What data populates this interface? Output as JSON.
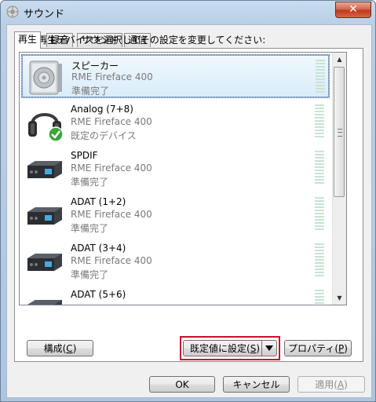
{
  "window": {
    "title": "サウンド",
    "close_label": "✕"
  },
  "tabs": [
    {
      "label": "再生",
      "active": true
    },
    {
      "label": "録音",
      "active": false
    },
    {
      "label": "サウンド",
      "active": false
    },
    {
      "label": "通信",
      "active": false
    }
  ],
  "instructions": "下の再生デバイスを選択してその設定を変更してください:",
  "devices": [
    {
      "name": "スピーカー",
      "driver": "RME Fireface 400",
      "status": "準備完了",
      "icon": "speaker-icon",
      "selected": true
    },
    {
      "name": "Analog (7+8)",
      "driver": "RME Fireface 400",
      "status": "既定のデバイス",
      "icon": "headphones-icon",
      "default": true
    },
    {
      "name": "SPDIF",
      "driver": "RME Fireface 400",
      "status": "準備完了",
      "icon": "audio-interface-icon"
    },
    {
      "name": "ADAT (1+2)",
      "driver": "RME Fireface 400",
      "status": "準備完了",
      "icon": "audio-interface-icon"
    },
    {
      "name": "ADAT (3+4)",
      "driver": "RME Fireface 400",
      "status": "準備完了",
      "icon": "audio-interface-icon"
    },
    {
      "name": "ADAT (5+6)",
      "driver": "",
      "status": "",
      "icon": "audio-interface-icon"
    }
  ],
  "buttons": {
    "configure": {
      "label": "構成(",
      "accel": "C",
      "tail": ")"
    },
    "set_default": {
      "label": "既定値に設定(",
      "accel": "S",
      "tail": ")"
    },
    "properties": {
      "label": "プロパティ(",
      "accel": "P",
      "tail": ")"
    },
    "ok": {
      "label": "OK"
    },
    "cancel": {
      "label": "キャンセル"
    },
    "apply": {
      "label": "適用(",
      "accel": "A",
      "tail": ")"
    }
  },
  "colors": {
    "highlight": "#c8102e",
    "default_check": "#3aa53a",
    "selection": "#d9ecfa"
  }
}
